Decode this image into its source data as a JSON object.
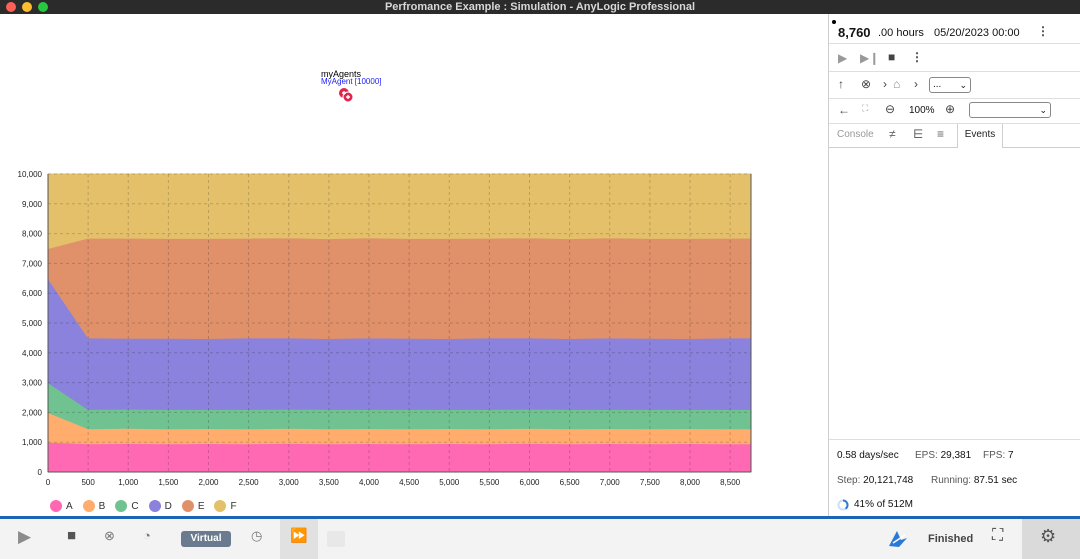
{
  "window": {
    "title": "Perfromance Example : Simulation - AnyLogic Professional"
  },
  "model": {
    "agent_population_name": "myAgents",
    "agent_population_sub": "MyAgent [10000]"
  },
  "chart_data": {
    "type": "area",
    "stacked": true,
    "title": "",
    "xlabel": "",
    "ylabel": "",
    "xlim": [
      0,
      8760
    ],
    "ylim": [
      0,
      10000
    ],
    "grid": true,
    "legend_position": "bottom-left",
    "x_ticks": [
      "0",
      "500",
      "1,000",
      "1,500",
      "2,000",
      "2,500",
      "3,000",
      "3,500",
      "4,000",
      "4,500",
      "5,000",
      "5,500",
      "6,000",
      "6,500",
      "7,000",
      "7,500",
      "8,000",
      "8,500"
    ],
    "y_ticks": [
      "0",
      "1,000",
      "2,000",
      "3,000",
      "4,000",
      "5,000",
      "6,000",
      "7,000",
      "8,000",
      "9,000",
      "10,000"
    ],
    "x": [
      0,
      500,
      1000,
      1500,
      2000,
      2500,
      3000,
      3500,
      4000,
      4500,
      5000,
      5500,
      6000,
      6500,
      7000,
      7500,
      8000,
      8500,
      8760
    ],
    "series": [
      {
        "name": "A",
        "color": "#ff69b4",
        "values": [
          1000,
          950,
          960,
          950,
          955,
          950,
          960,
          950,
          955,
          950,
          955,
          950,
          960,
          950,
          955,
          950,
          955,
          950,
          950
        ]
      },
      {
        "name": "B",
        "color": "#ffac6c",
        "values": [
          1000,
          500,
          510,
          500,
          505,
          500,
          510,
          500,
          505,
          500,
          505,
          500,
          510,
          500,
          505,
          500,
          505,
          500,
          500
        ]
      },
      {
        "name": "C",
        "color": "#70c390",
        "values": [
          1000,
          650,
          640,
          650,
          640,
          650,
          640,
          650,
          640,
          650,
          640,
          650,
          640,
          650,
          640,
          650,
          640,
          650,
          650
        ]
      },
      {
        "name": "D",
        "color": "#8a82dc",
        "values": [
          3500,
          2400,
          2380,
          2390,
          2380,
          2400,
          2390,
          2380,
          2400,
          2390,
          2380,
          2400,
          2390,
          2380,
          2400,
          2390,
          2380,
          2400,
          2400
        ]
      },
      {
        "name": "E",
        "color": "#e0916a",
        "values": [
          1000,
          3350,
          3360,
          3350,
          3360,
          3350,
          3360,
          3350,
          3360,
          3350,
          3360,
          3350,
          3360,
          3350,
          3360,
          3350,
          3360,
          3350,
          3350
        ]
      },
      {
        "name": "F",
        "color": "#e4c06a",
        "values": [
          2500,
          2150,
          2150,
          2160,
          2160,
          2150,
          2140,
          2170,
          2140,
          2160,
          2160,
          2150,
          2140,
          2170,
          2140,
          2160,
          2155,
          2150,
          2150
        ]
      }
    ]
  },
  "panel": {
    "time_value": "8,760",
    "time_decimals": ".00 hours",
    "date": "05/20/2023 00:00",
    "zoom": "100%",
    "nav_select": "...",
    "zoom_select": "",
    "tabs": {
      "console": "Console",
      "events": "Events"
    },
    "stats": {
      "speed": "0.58 days/sec",
      "eps_label": "EPS:",
      "eps": "29,381",
      "fps_label": "FPS:",
      "fps": "7",
      "step_label": "Step:",
      "step": "20,121,748",
      "running_label": "Running:",
      "running": "87.51 sec",
      "memory": "41% of 512M"
    }
  },
  "toolbar": {
    "virtual_label": "Virtual",
    "status": "Finished"
  },
  "icons": {
    "run": "play-icon",
    "stop": "stop-icon",
    "step": "step-icon",
    "up": "arrow-up-icon",
    "cancel": "cancel-icon",
    "home": "home-icon",
    "back": "arrow-left-icon",
    "zoom_out": "zoom-out-icon",
    "zoom_in": "zoom-in-icon",
    "settings": "gear-icon",
    "fullscreen": "fullscreen-icon",
    "anylogic": "anylogic-logo-icon"
  }
}
